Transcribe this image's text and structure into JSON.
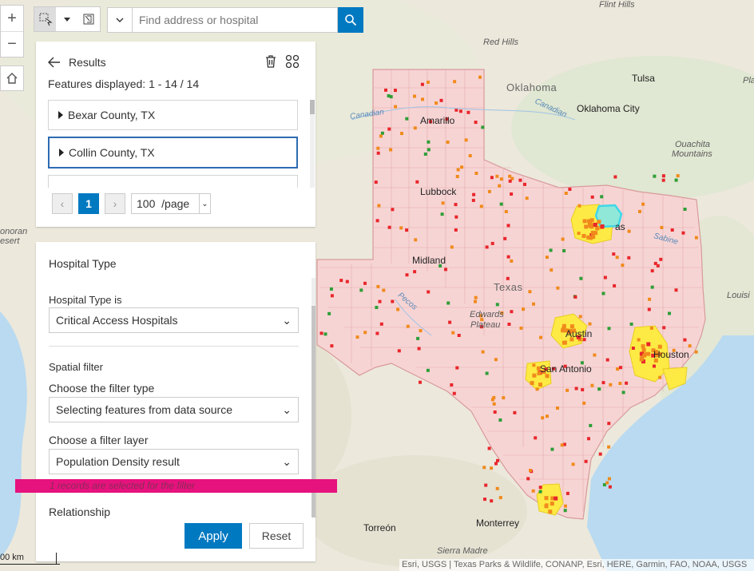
{
  "search": {
    "placeholder": "Find address or hospital"
  },
  "results": {
    "title": "Results",
    "count": "Features displayed: 1 - 14 / 14",
    "items": [
      {
        "label": "Bexar County, TX"
      },
      {
        "label": "Collin County, TX"
      }
    ],
    "page": "1",
    "page_size": "100",
    "page_unit": "/page"
  },
  "filter": {
    "title": "Hospital Type",
    "type_label": "Hospital Type is",
    "type_value": "Critical Access Hospitals",
    "spatial_label": "Spatial filter",
    "filter_type_label": "Choose the filter type",
    "filter_type_value": "Selecting features from data source",
    "layer_label": "Choose a filter layer",
    "layer_value": "Population Density result",
    "selection_msg": "1 records are selected for the filter",
    "relationship_label": "Relationship",
    "apply_label": "Apply",
    "reset_label": "Reset"
  },
  "map": {
    "labels": {
      "flint_hills": "Flint Hills",
      "red_hills": "Red Hills",
      "oklahoma": "Oklahoma",
      "tulsa": "Tulsa",
      "pla": "Pla",
      "canadian1": "Canadian",
      "canadian2": "Canadian",
      "okc": "Oklahoma City",
      "amarillo": "Amarillo",
      "ouachita": "Ouachita",
      "mountains": "Mountains",
      "lubbock": "Lubbock",
      "dallas": "as",
      "sabine": "Sabine",
      "sonoran": "onoran",
      "desert": "esert",
      "midland": "Midland",
      "texas": "Texas",
      "louisi": "Louisi",
      "pecos": "Pecos",
      "edwards": "Edwards",
      "plateau": "Plateau",
      "austin": "Austin",
      "houston": "Houston",
      "san_antonio": "San Antonio",
      "torreon": "Torreón",
      "monterrey": "Monterrey",
      "sierra": "Sierra Madre"
    },
    "scale_label": "00 km",
    "attribution": "Esri, USGS | Texas Parks & Wildlife, CONANP, Esri, HERE, Garmin, FAO, NOAA, USGS",
    "colors": {
      "state_fill": "#f7d4d4",
      "highlight": "#ffec3d",
      "selected": "#47e0e0",
      "accent": "#0079c1",
      "alert": "#e6127d"
    }
  }
}
